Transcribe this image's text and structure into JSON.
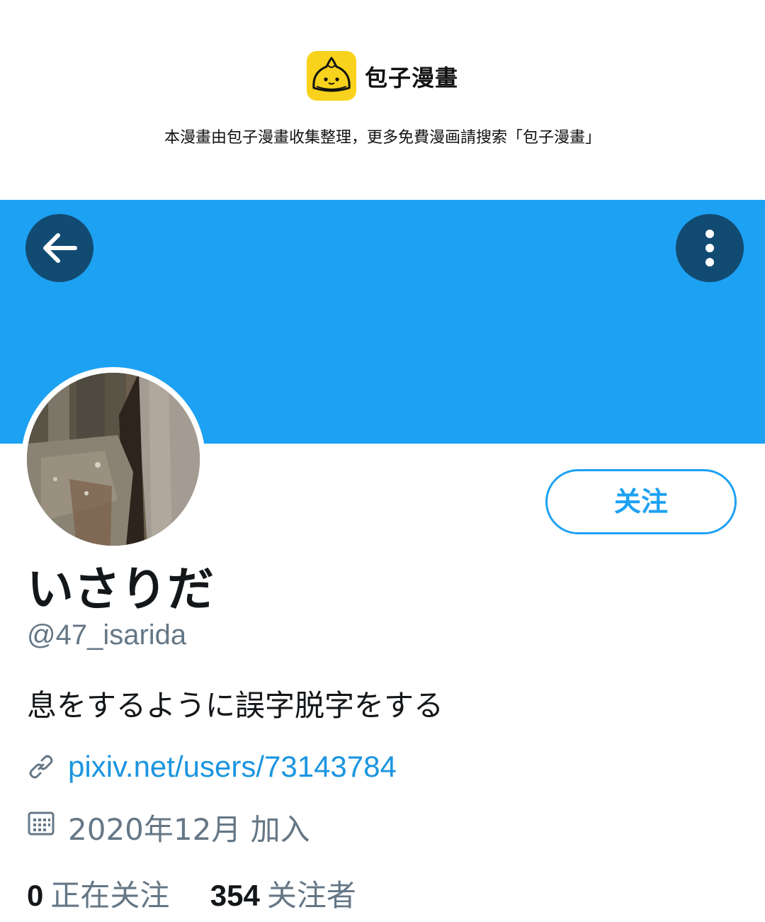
{
  "watermark": {
    "logo_name": "bun-logo-icon",
    "site_name": "包子漫畫",
    "notice": "本漫畫由包子漫畫收集整理，更多免費漫画請搜索「包子漫畫」"
  },
  "header": {
    "banner_color": "#1da1f2",
    "back_icon": "arrow-left-icon",
    "more_icon": "more-vertical-icon"
  },
  "profile": {
    "follow_label": "关注",
    "display_name": "いさりだ",
    "handle": "@47_isarida",
    "bio": "息をするように誤字脱字をする",
    "link": "pixiv.net/users/73143784",
    "link_icon": "link-icon",
    "joined": "2020年12月 加入",
    "joined_icon": "calendar-icon"
  },
  "stats": [
    {
      "value": "0",
      "label": "正在关注"
    },
    {
      "value": "354",
      "label": "关注者"
    }
  ],
  "colors": {
    "accent": "#1da1f2",
    "link": "#1b95e0",
    "secondary_text": "#657786",
    "primary_text": "#14171a"
  }
}
